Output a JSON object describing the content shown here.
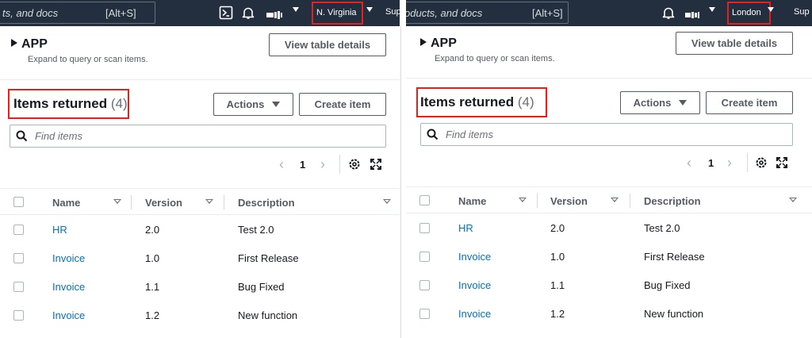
{
  "left": {
    "nav": {
      "search_placeholder": "ts, and docs",
      "search_shortcut": "[Alt+S]",
      "region": "N. Virginia",
      "support": "Sup"
    }
  },
  "right": {
    "nav": {
      "search_placeholder": "oducts, and docs",
      "search_shortcut": "[Alt+S]",
      "region": "London",
      "support": "Sup"
    }
  },
  "app": {
    "title": "APP",
    "subtitle": "Expand to query or scan items.",
    "view_table_details": "View table details"
  },
  "items": {
    "title": "Items returned",
    "count": "(4)",
    "actions_label": "Actions",
    "create_label": "Create item",
    "find_placeholder": "Find items"
  },
  "pagination": {
    "current_page": "1"
  },
  "table": {
    "columns": [
      "Name",
      "Version",
      "Description"
    ],
    "rows": [
      {
        "name": "HR",
        "version": "2.0",
        "description": "Test 2.0"
      },
      {
        "name": "Invoice",
        "version": "1.0",
        "description": "First Release"
      },
      {
        "name": "Invoice",
        "version": "1.1",
        "description": "Bug Fixed"
      },
      {
        "name": "Invoice",
        "version": "1.2",
        "description": "New function"
      }
    ]
  },
  "colors": {
    "nav_background": "#232f3e",
    "highlight_border": "#e3221e",
    "link": "#0073bb"
  },
  "icons": [
    "cloudshell-icon",
    "bell-icon",
    "search-icon",
    "settings-icon",
    "fullscreen-icon",
    "caret-down-icon",
    "sort-icon"
  ]
}
